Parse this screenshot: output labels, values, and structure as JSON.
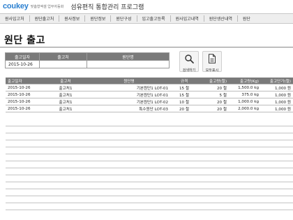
{
  "header": {
    "logo": "coukey",
    "logo_sub": "맞춤형엑셀 업무자동화",
    "title": "섬유편직 통합관리 프로그램"
  },
  "nav": {
    "items": [
      "원사입고처",
      "원단출고처",
      "원사정보",
      "원단정보",
      "원단구성",
      "입고출고등록",
      "원사입고내역",
      "원단생산내역",
      "원단"
    ]
  },
  "page": {
    "title": "원단 출고"
  },
  "search_form": {
    "headers": [
      "출고일자",
      "출고처",
      "원단명"
    ],
    "values": [
      "2015-10-26",
      "",
      ""
    ]
  },
  "buttons": {
    "search_label": "검색하기",
    "show_all_label": "모두표시"
  },
  "table": {
    "columns": [
      "출고일자",
      "출고처",
      "원단명",
      "규격",
      "출고량(절)",
      "출고량(Kg)",
      "출고단가(절)"
    ],
    "rows": [
      [
        "2015-10-26",
        "출고처1",
        "기본원단1 LOT-01",
        "15 절",
        "20 절",
        "1,500.0 kg",
        "1,000 원"
      ],
      [
        "2015-10-26",
        "출고처1",
        "기본원단1 LOT-01",
        "15 절",
        "5 절",
        "375.0 kg",
        "1,000 원"
      ],
      [
        "2015-10-26",
        "출고처1",
        "기본원단1 LOT-02",
        "10 절",
        "20 절",
        "1,000.0 kg",
        "1,000 원"
      ],
      [
        "2015-10-26",
        "출고처1",
        "특수원단 LOT-03",
        "20 절",
        "20 절",
        "2,000.0 kg",
        "1,000 원"
      ]
    ]
  },
  "icons": {
    "search": "magnifier-icon",
    "show_all": "document-icon"
  }
}
